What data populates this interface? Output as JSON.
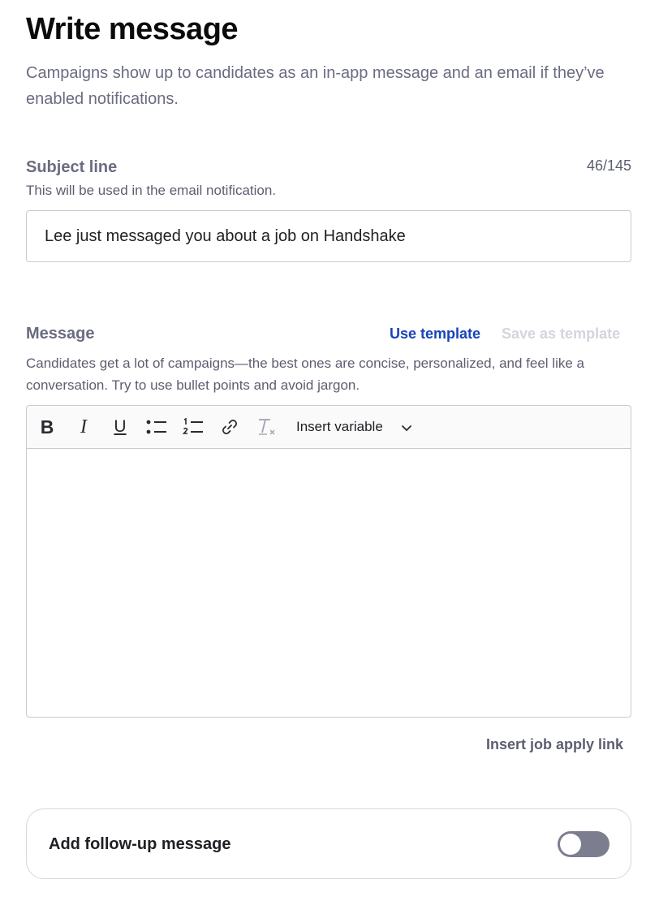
{
  "header": {
    "title": "Write message",
    "description": "Campaigns show up to candidates as an in-app message and an email if they’ve enabled notifications."
  },
  "subject": {
    "label": "Subject line",
    "hint": "This will be used in the email notification.",
    "count": "46/145",
    "value": "Lee just messaged you about a job on Handshake"
  },
  "message": {
    "label": "Message",
    "use_template": "Use template",
    "save_template": "Save as template",
    "hint": "Candidates get a lot of campaigns—the best ones are concise, personalized, and feel like a conversation. Try to use bullet points and avoid jargon.",
    "body": ""
  },
  "toolbar": {
    "bold": "B",
    "italic": "I",
    "underline": "U",
    "insert_variable": "Insert variable",
    "icons": [
      "bold-icon",
      "italic-icon",
      "underline-icon",
      "bulleted-list-icon",
      "numbered-list-icon",
      "link-icon",
      "clear-format-icon",
      "chevron-down-icon"
    ]
  },
  "job_apply_link": "Insert job apply link",
  "followup": {
    "label": "Add follow-up message",
    "enabled": false
  },
  "colors": {
    "accent": "#1944b8",
    "muted_text": "#6a6c80",
    "disabled_text": "#d3d5de",
    "toggle_off": "#7c7e90"
  }
}
